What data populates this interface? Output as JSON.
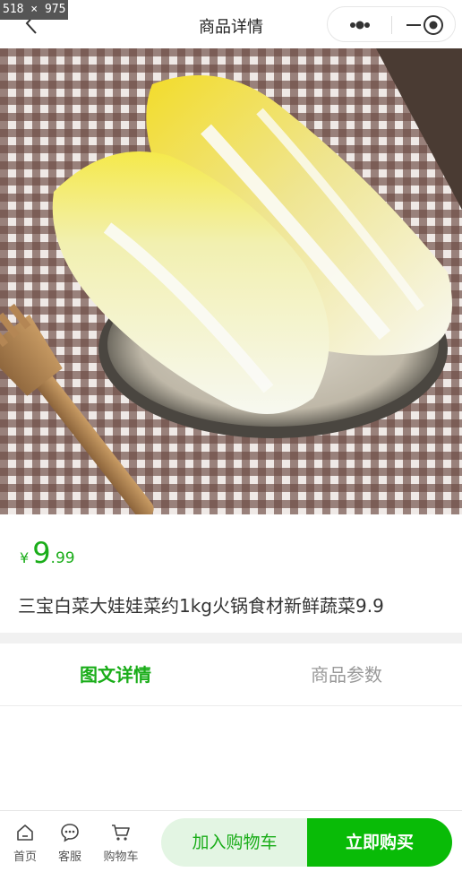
{
  "screen_badge": "518 × 975",
  "header": {
    "title": "商品详情",
    "back_icon": "chevron-left-icon",
    "capsule_icons": [
      "more-dots-icon",
      "minimize-icon",
      "close-target-icon"
    ]
  },
  "product": {
    "image_subject": "napa-cabbage-photo",
    "price_currency": "¥",
    "price_integer": "9",
    "price_decimal": ".99",
    "title": "三宝白菜大娃娃菜约1kg火锅食材新鲜蔬菜9.9"
  },
  "tabs": [
    {
      "label": "图文详情",
      "active": true
    },
    {
      "label": "商品参数",
      "active": false
    }
  ],
  "bottom_bar": {
    "home_label": "首页",
    "service_label": "客服",
    "cart_label": "购物车",
    "add_to_cart_label": "加入购物车",
    "buy_now_label": "立即购买"
  },
  "colors": {
    "accent": "#1aad19",
    "buy_button": "#09bb07",
    "add_button_bg": "#e3f5e3"
  }
}
